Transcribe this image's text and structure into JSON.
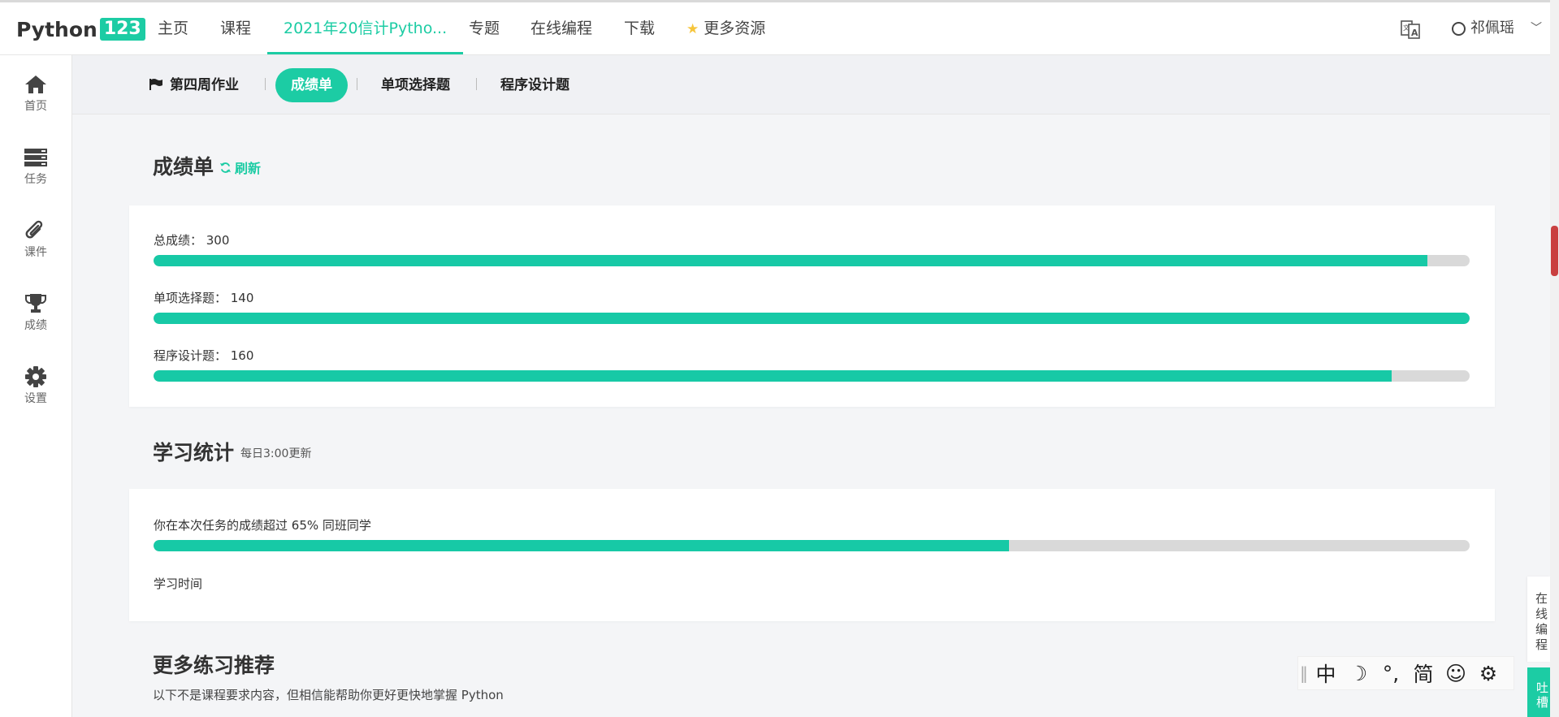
{
  "logo": {
    "text": "Python",
    "badge": "123"
  },
  "nav": {
    "items": [
      "主页",
      "课程",
      "2021年20信计Pytho...",
      "专题",
      "在线编程",
      "下载"
    ],
    "more": "更多资源",
    "user": "祁佩瑶",
    "icons": {
      "translate": "translate-icon",
      "user": "user-circle-icon",
      "more": "star-icon"
    },
    "accent": "#1ccca4",
    "star_color": "#f6c53b"
  },
  "sidebar": {
    "items": [
      {
        "label": "首页",
        "icon": "home-icon"
      },
      {
        "label": "任务",
        "icon": "tasks-icon"
      },
      {
        "label": "课件",
        "icon": "paperclip-icon"
      },
      {
        "label": "成绩",
        "icon": "trophy-icon"
      },
      {
        "label": "设置",
        "icon": "gear-icon"
      }
    ]
  },
  "subtabs": {
    "items": [
      "第四周作业",
      "成绩单",
      "单项选择题",
      "程序设计题"
    ],
    "active": "成绩单"
  },
  "scores": {
    "title": "成绩单",
    "refresh": "刷新",
    "bars": [
      {
        "label": "总成绩： 300",
        "progress": 0.968
      },
      {
        "label": "单项选择题： 140",
        "progress": 1.0
      },
      {
        "label": "程序设计题： 160",
        "progress": 0.941
      }
    ],
    "bar_color": "#17c9a6",
    "track_color": "#d9d9d9"
  },
  "stats": {
    "title": "学习统计",
    "note": "每日3:00更新",
    "exceed_text": "你在本次任务的成绩超过 65% 同班同学",
    "exceed_progress": 0.65,
    "time_label": "学习时间"
  },
  "more": {
    "title": "更多练习推荐",
    "subtitle": "以下不是课程要求内容，但相信能帮助你更好更快地掌握 Python"
  },
  "widgets": {
    "online": "在线编程",
    "feedback": "吐槽",
    "ime": [
      "中",
      "☽",
      "°,",
      "简",
      "☺",
      "⚙"
    ]
  }
}
